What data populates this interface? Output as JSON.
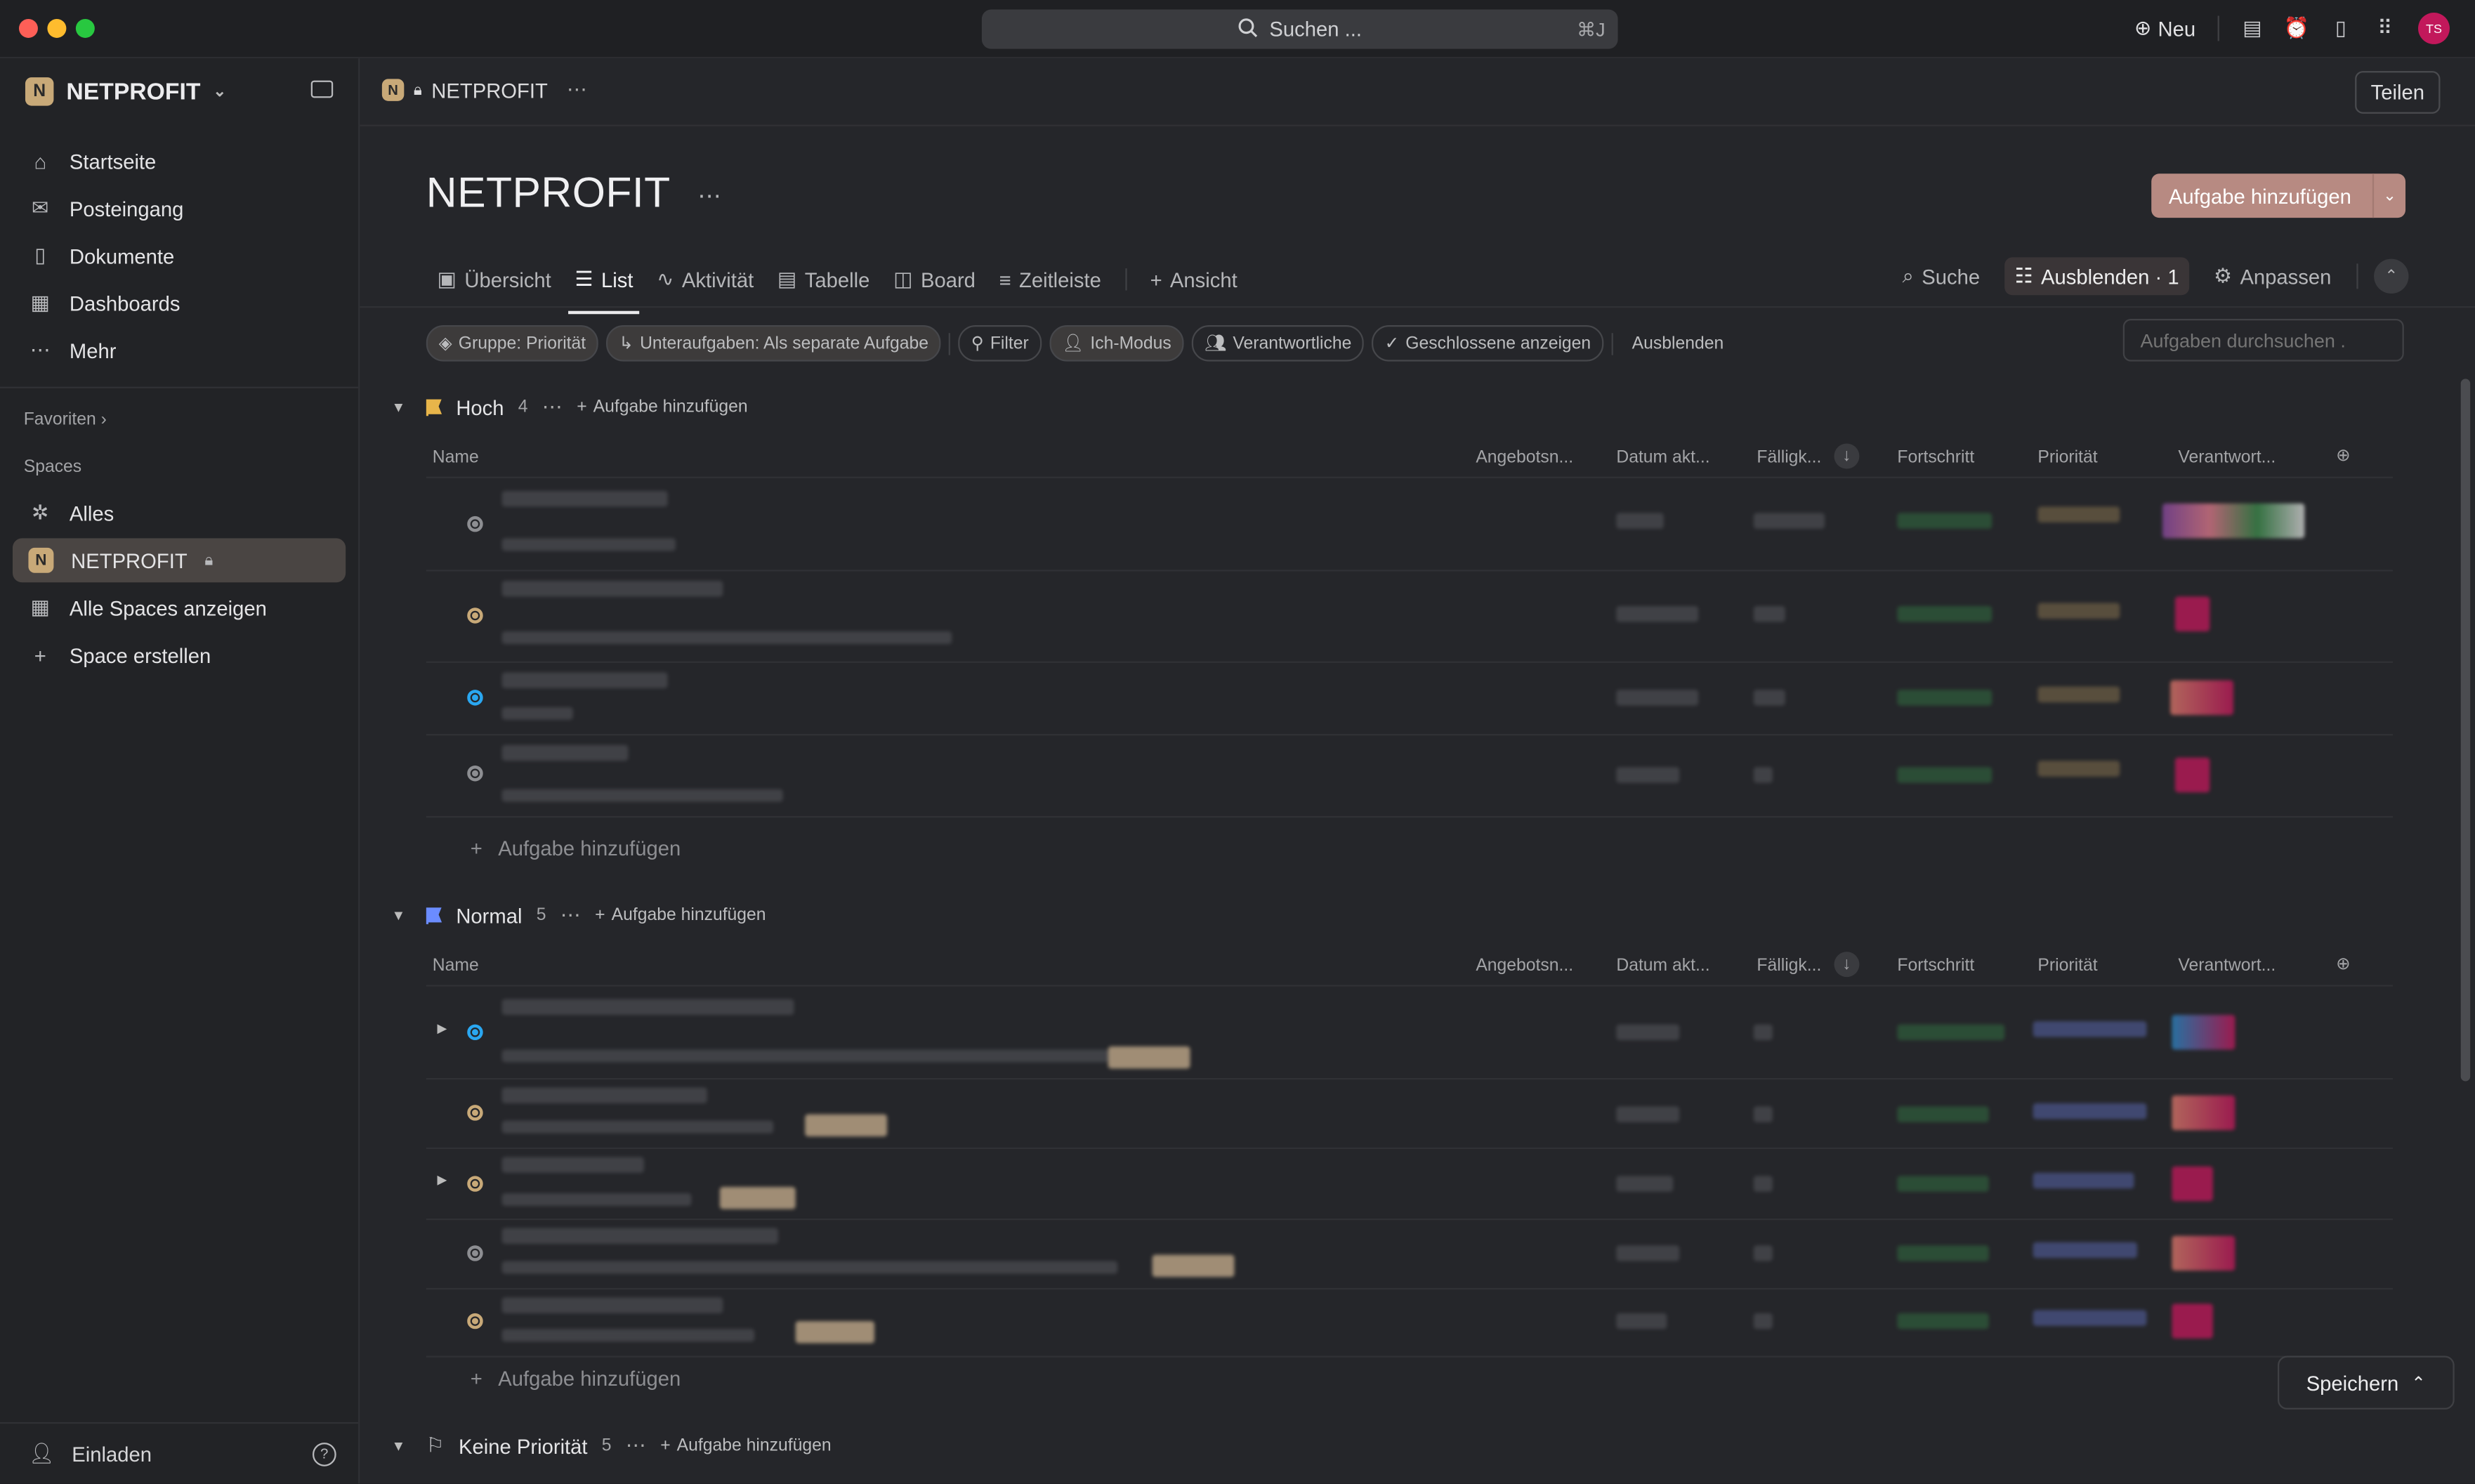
{
  "titlebar": {
    "search_label": "Suchen ...",
    "search_shortcut": "⌘J",
    "new_label": "Neu",
    "avatar_initials": "TS"
  },
  "sidebar": {
    "workspace": "NETPROFIT",
    "items": [
      {
        "label": "Startseite",
        "icon": "home-icon"
      },
      {
        "label": "Posteingang",
        "icon": "inbox-icon"
      },
      {
        "label": "Dokumente",
        "icon": "document-icon"
      },
      {
        "label": "Dashboards",
        "icon": "dashboard-icon"
      },
      {
        "label": "Mehr",
        "icon": "more-icon"
      }
    ],
    "favorites_label": "Favoriten",
    "spaces_label": "Spaces",
    "spaces": [
      {
        "label": "Alles"
      },
      {
        "label": "NETPROFIT"
      },
      {
        "label": "Alle Spaces anzeigen"
      },
      {
        "label": "Space erstellen"
      }
    ],
    "invite_label": "Einladen"
  },
  "header": {
    "breadcrumb": "NETPROFIT",
    "share_label": "Teilen"
  },
  "page": {
    "title": "NETPROFIT",
    "add_task_label": "Aufgabe hinzufügen"
  },
  "tabs": [
    "Übersicht",
    "List",
    "Aktivität",
    "Tabelle",
    "Board",
    "Zeitleiste",
    "Ansicht"
  ],
  "toolbar": {
    "search": "Suche",
    "hide": "Ausblenden · 1",
    "customize": "Anpassen"
  },
  "filters": {
    "group": "Gruppe: Priorität",
    "subtasks": "Unteraufgaben: Als separate Aufgabe",
    "filter": "Filter",
    "me_mode": "Ich-Modus",
    "assignees": "Verantwortliche",
    "show_closed": "Geschlossene anzeigen",
    "hide": "Ausblenden",
    "task_search_placeholder": "Aufgaben durchsuchen ."
  },
  "columns": [
    "Name",
    "Angebotsn...",
    "Datum akt...",
    "Fälligk...",
    "Fortschritt",
    "Priorität",
    "Verantwort..."
  ],
  "groups": [
    {
      "name": "Hoch",
      "count": "4",
      "add_label": "Aufgabe hinzufügen",
      "flag_color": "#e8b54a"
    },
    {
      "name": "Normal",
      "count": "5",
      "add_label": "Aufgabe hinzufügen",
      "flag_color": "#6b8cff"
    },
    {
      "name": "Keine Priorität",
      "count": "5",
      "add_label": "Aufgabe hinzufügen",
      "flag_color": "#bdbec1"
    }
  ],
  "add_task_row_label": "Aufgabe hinzufügen",
  "save_label": "Speichern"
}
